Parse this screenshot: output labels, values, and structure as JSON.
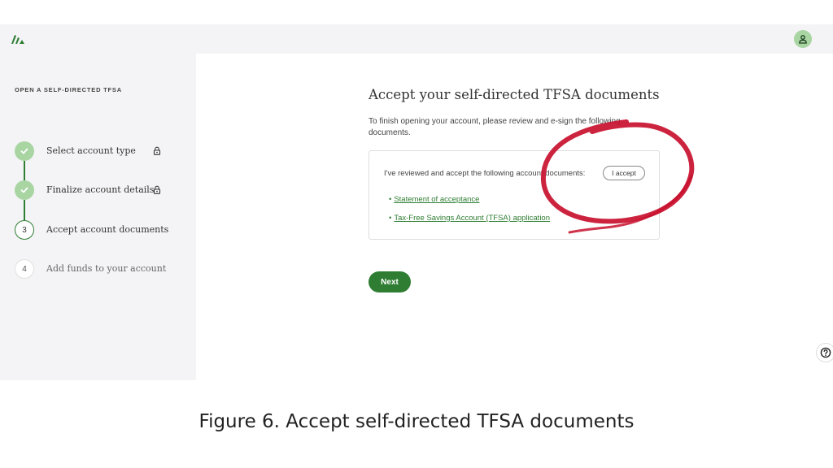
{
  "sidebar": {
    "heading": "OPEN A SELF-DIRECTED TFSA",
    "steps": [
      {
        "label": "Select account type",
        "state": "done",
        "locked": true
      },
      {
        "label": "Finalize account details",
        "state": "done",
        "locked": true
      },
      {
        "label": "Accept account documents",
        "number": "3",
        "state": "current",
        "locked": false
      },
      {
        "label": "Add funds to your account",
        "number": "4",
        "state": "todo",
        "locked": false
      }
    ]
  },
  "main": {
    "title": "Accept your self-directed TFSA documents",
    "description": "To finish opening your account, please review and e-sign the following documents.",
    "card": {
      "review_text": "I've reviewed and accept the following account documents:",
      "accept_label": "I accept",
      "documents": [
        "Statement of acceptance",
        "Tax-Free Savings Account (TFSA) application"
      ]
    },
    "next_label": "Next"
  },
  "caption": "Figure 6.  Accept self-directed TFSA documents",
  "colors": {
    "brand_green": "#2e7d32",
    "light_green": "#a8d5a2",
    "annotation_red": "#c8102e",
    "panel_gray": "#f4f4f6"
  },
  "icons": {
    "logo": "wealthsimple-logo-icon",
    "profile": "user-icon",
    "check": "checkmark-icon",
    "lock": "lock-icon",
    "help": "help-icon"
  }
}
